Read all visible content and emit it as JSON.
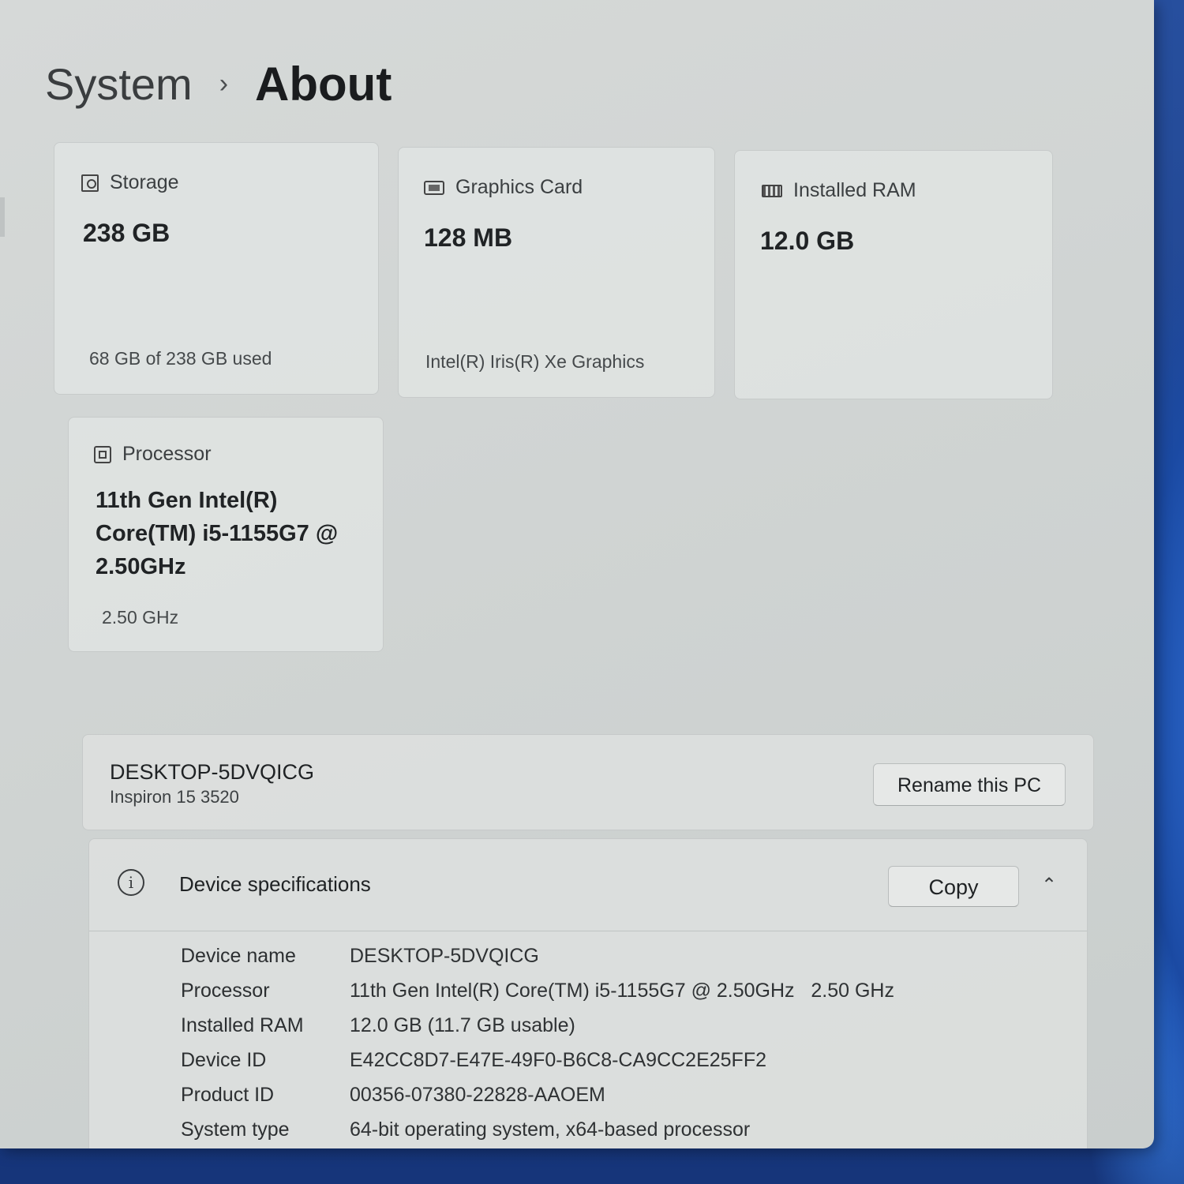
{
  "breadcrumb": {
    "parent": "System",
    "separator": "›",
    "current": "About"
  },
  "cards": {
    "storage": {
      "icon": "storage-icon",
      "title": "Storage",
      "value": "238 GB",
      "sub": "68 GB of 238 GB used"
    },
    "graphics": {
      "icon": "graphics-card-icon",
      "title": "Graphics Card",
      "value": "128 MB",
      "sub": "Intel(R) Iris(R) Xe Graphics"
    },
    "ram": {
      "icon": "ram-icon",
      "title": "Installed RAM",
      "value": "12.0 GB"
    },
    "processor": {
      "icon": "processor-icon",
      "title": "Processor",
      "value": "11th Gen Intel(R) Core(TM) i5-1155G7 @ 2.50GHz",
      "sub": "2.50 GHz"
    }
  },
  "pc": {
    "name": "DESKTOP-5DVQICG",
    "model": "Inspiron 15 3520",
    "rename_label": "Rename this PC"
  },
  "specs": {
    "title": "Device specifications",
    "copy_label": "Copy",
    "chevron": "⌃",
    "rows": [
      {
        "label": "Device name",
        "value": "DESKTOP-5DVQICG"
      },
      {
        "label": "Processor",
        "value": "11th Gen Intel(R) Core(TM) i5-1155G7 @ 2.50GHz   2.50 GHz"
      },
      {
        "label": "Installed RAM",
        "value": "12.0 GB (11.7 GB usable)"
      },
      {
        "label": "Device ID",
        "value": "E42CC8D7-E47E-49F0-B6C8-CA9CC2E25FF2"
      },
      {
        "label": "Product ID",
        "value": "00356-07380-22828-AAOEM"
      },
      {
        "label": "System type",
        "value": "64-bit operating system, x64-based processor"
      }
    ]
  }
}
